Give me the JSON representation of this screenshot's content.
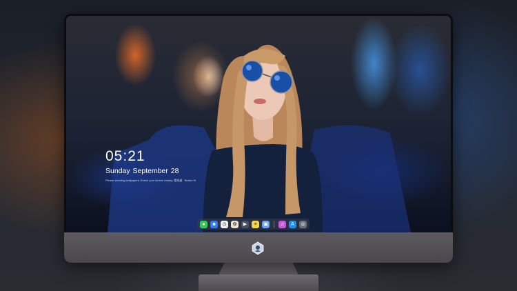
{
  "lock_screen": {
    "time": "05:21",
    "date": "Sunday September  28",
    "tagline": "Please stunning wallpapers. Enrich your screen beauty. 壁纸桌 · Button Hi"
  },
  "dock": {
    "apps": [
      {
        "icon": "messages-icon",
        "glyph": "●",
        "color": "#34c759"
      },
      {
        "icon": "finder-icon",
        "glyph": "☻",
        "color": "#2f7cf6"
      },
      {
        "icon": "clock-icon",
        "glyph": "◷",
        "color": "#f2f2f2"
      },
      {
        "icon": "photos-icon",
        "glyph": "✿",
        "color": "#e7e2d3"
      },
      {
        "icon": "video-editor-icon",
        "glyph": "▶",
        "color": "#4a5261"
      },
      {
        "icon": "notes-icon",
        "glyph": "≡",
        "color": "#f3d44a"
      },
      {
        "icon": "preview-icon",
        "glyph": "▣",
        "color": "#6aa5e8"
      },
      {
        "icon": "itunes-icon",
        "glyph": "♫",
        "color": "#c85bd9"
      },
      {
        "icon": "app-store-icon",
        "glyph": "A",
        "color": "#1d8ff2"
      },
      {
        "icon": "screenshot-icon",
        "glyph": "◎",
        "color": "#6b6f78"
      }
    ]
  },
  "colors": {
    "bezel": "#0c0c0e",
    "chin": "#524f55",
    "lock_text": "#ffffff"
  }
}
